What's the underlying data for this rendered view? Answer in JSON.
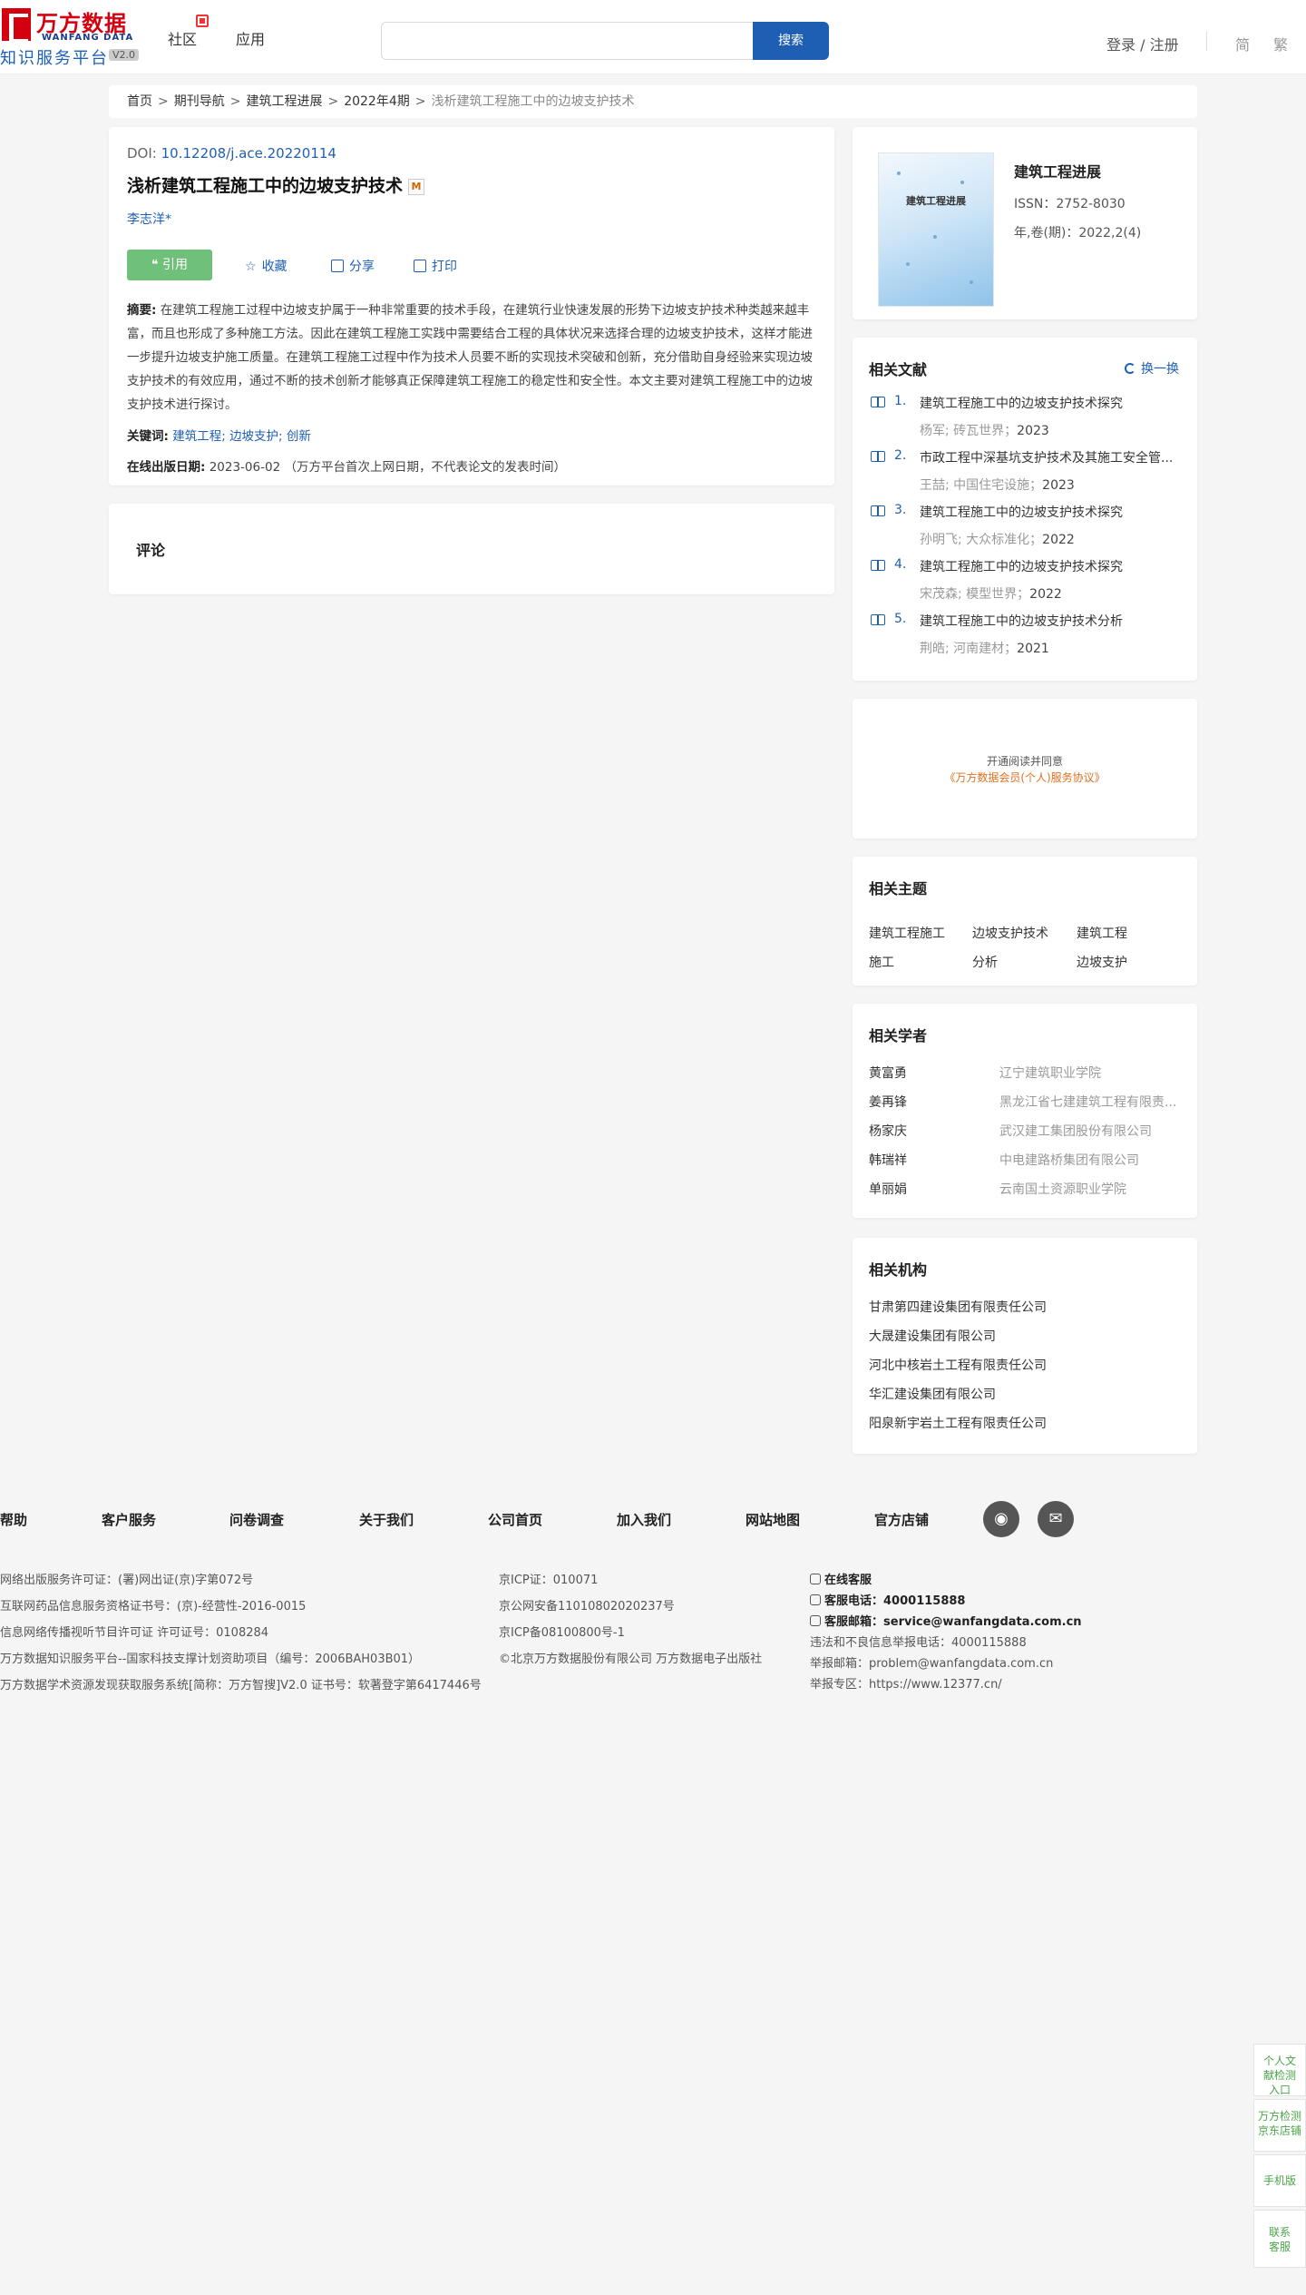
{
  "header": {
    "logo_cn": "万方数据",
    "logo_en": "WANFANG DATA",
    "logo_sub": "知识服务平台",
    "logo_version": "V2.0",
    "nav": [
      "社区",
      "应用"
    ],
    "search_placeholder": "",
    "search_button": "搜索",
    "login": "登录 / 注册",
    "lang_simplified": "简",
    "lang_traditional": "繁"
  },
  "breadcrumb": [
    "首页",
    "期刊导航",
    "建筑工程进展",
    "2022年4期",
    "浅析建筑工程施工中的边坡支护技术"
  ],
  "article": {
    "doi_label": "DOI:",
    "doi": "10.12208/j.ace.20220114",
    "title": "浅析建筑工程施工中的边坡支护技术",
    "author": "李志洋*",
    "cite_button": "引用",
    "actions": [
      "收藏",
      "分享",
      "打印"
    ],
    "abstract_label": "摘要:",
    "abstract": "在建筑工程施工过程中边坡支护属于一种非常重要的技术手段，在建筑行业快速发展的形势下边坡支护技术种类越来越丰富，而且也形成了多种施工方法。因此在建筑工程施工实践中需要结合工程的具体状况来选择合理的边坡支护技术，这样才能进一步提升边坡支护施工质量。在建筑工程施工过程中作为技术人员要不断的实现技术突破和创新，充分借助自身经验来实现边坡支护技术的有效应用，通过不断的技术创新才能够真正保障建筑工程施工的稳定性和安全性。本文主要对建筑工程施工中的边坡支护技术进行探讨。",
    "keywords_label": "关键词:",
    "keywords": [
      "建筑工程;",
      "边坡支护;",
      "创新"
    ],
    "pubdate_label": "在线出版日期:",
    "pubdate": "2023-06-02  （万方平台首次上网日期，不代表论文的发表时间）"
  },
  "comment": {
    "title": "评论"
  },
  "journal": {
    "cover_title": "建筑工程进展",
    "name": "建筑工程进展",
    "issn": "ISSN：2752-8030",
    "volume": "年,卷(期)：2022,2(4)"
  },
  "related": {
    "title": "相关文献",
    "refresh": "换一换",
    "items": [
      {
        "num": "1.",
        "title": "建筑工程施工中的边坡支护技术探究",
        "meta": "杨军; 砖瓦世界；",
        "year": "2023"
      },
      {
        "num": "2.",
        "title": "市政工程中深基坑支护技术及其施工安全管...",
        "meta": "王喆; 中国住宅设施；",
        "year": "2023"
      },
      {
        "num": "3.",
        "title": "建筑工程施工中的边坡支护技术探究",
        "meta": "孙明飞; 大众标准化；",
        "year": "2022"
      },
      {
        "num": "4.",
        "title": "建筑工程施工中的边坡支护技术探究",
        "meta": "宋茂森; 模型世界；",
        "year": "2022"
      },
      {
        "num": "5.",
        "title": "建筑工程施工中的边坡支护技术分析",
        "meta": "荆皓; 河南建材；",
        "year": "2021"
      }
    ]
  },
  "promo": {
    "line1": "开通阅读并同意",
    "line2": "《万方数据会员(个人)服务协议》"
  },
  "topics": {
    "title": "相关主题",
    "items": [
      "建筑工程施工",
      "边坡支护技术",
      "建筑工程",
      "施工",
      "分析",
      "边坡支护"
    ]
  },
  "scholars": {
    "title": "相关学者",
    "items": [
      {
        "name": "黄富勇",
        "org": "辽宁建筑职业学院"
      },
      {
        "name": "姜再锋",
        "org": "黑龙江省七建建筑工程有限责..."
      },
      {
        "name": "杨家庆",
        "org": "武汉建工集团股份有限公司"
      },
      {
        "name": "韩瑞祥",
        "org": "中电建路桥集团有限公司"
      },
      {
        "name": "单丽娟",
        "org": "云南国土资源职业学院"
      }
    ]
  },
  "orgs": {
    "title": "相关机构",
    "items": [
      "甘肃第四建设集团有限责任公司",
      "大晟建设集团有限公司",
      "河北中核岩土工程有限责任公司",
      "华汇建设集团有限公司",
      "阳泉新宇岩土工程有限责任公司"
    ]
  },
  "footer": {
    "nav": [
      "帮助",
      "客户服务",
      "问卷调查",
      "关于我们",
      "公司首页",
      "加入我们",
      "网站地图",
      "官方店铺"
    ],
    "col1": [
      "网络出版服务许可证：(署)网出证(京)字第072号",
      "互联网药品信息服务资格证书号：(京)-经营性-2016-0015",
      "信息网络传播视听节目许可证 许可证号：0108284",
      "万方数据知识服务平台--国家科技支撑计划资助项目（编号：2006BAH03B01）",
      "万方数据学术资源发现获取服务系统[简称：万方智搜]V2.0 证书号：软著登字第6417446号"
    ],
    "col2": [
      "京ICP证：010071",
      "京公网安备11010802020237号",
      "京ICP备08100800号-1",
      "©北京万方数据股份有限公司 万方数据电子出版社"
    ],
    "online_service": "在线客服",
    "phone_label": "客服电话：",
    "phone": "4000115888",
    "email_label": "客服邮箱：",
    "email": "service@wanfangdata.com.cn",
    "report_phone": "违法和不良信息举报电话：4000115888",
    "report_email": "举报邮箱：problem@wanfangdata.com.cn",
    "report_zone": "举报专区：https://www.12377.cn/"
  },
  "side": [
    "个人文献检测入口",
    "万方检测京东店铺",
    "手机版",
    "联系客服"
  ]
}
